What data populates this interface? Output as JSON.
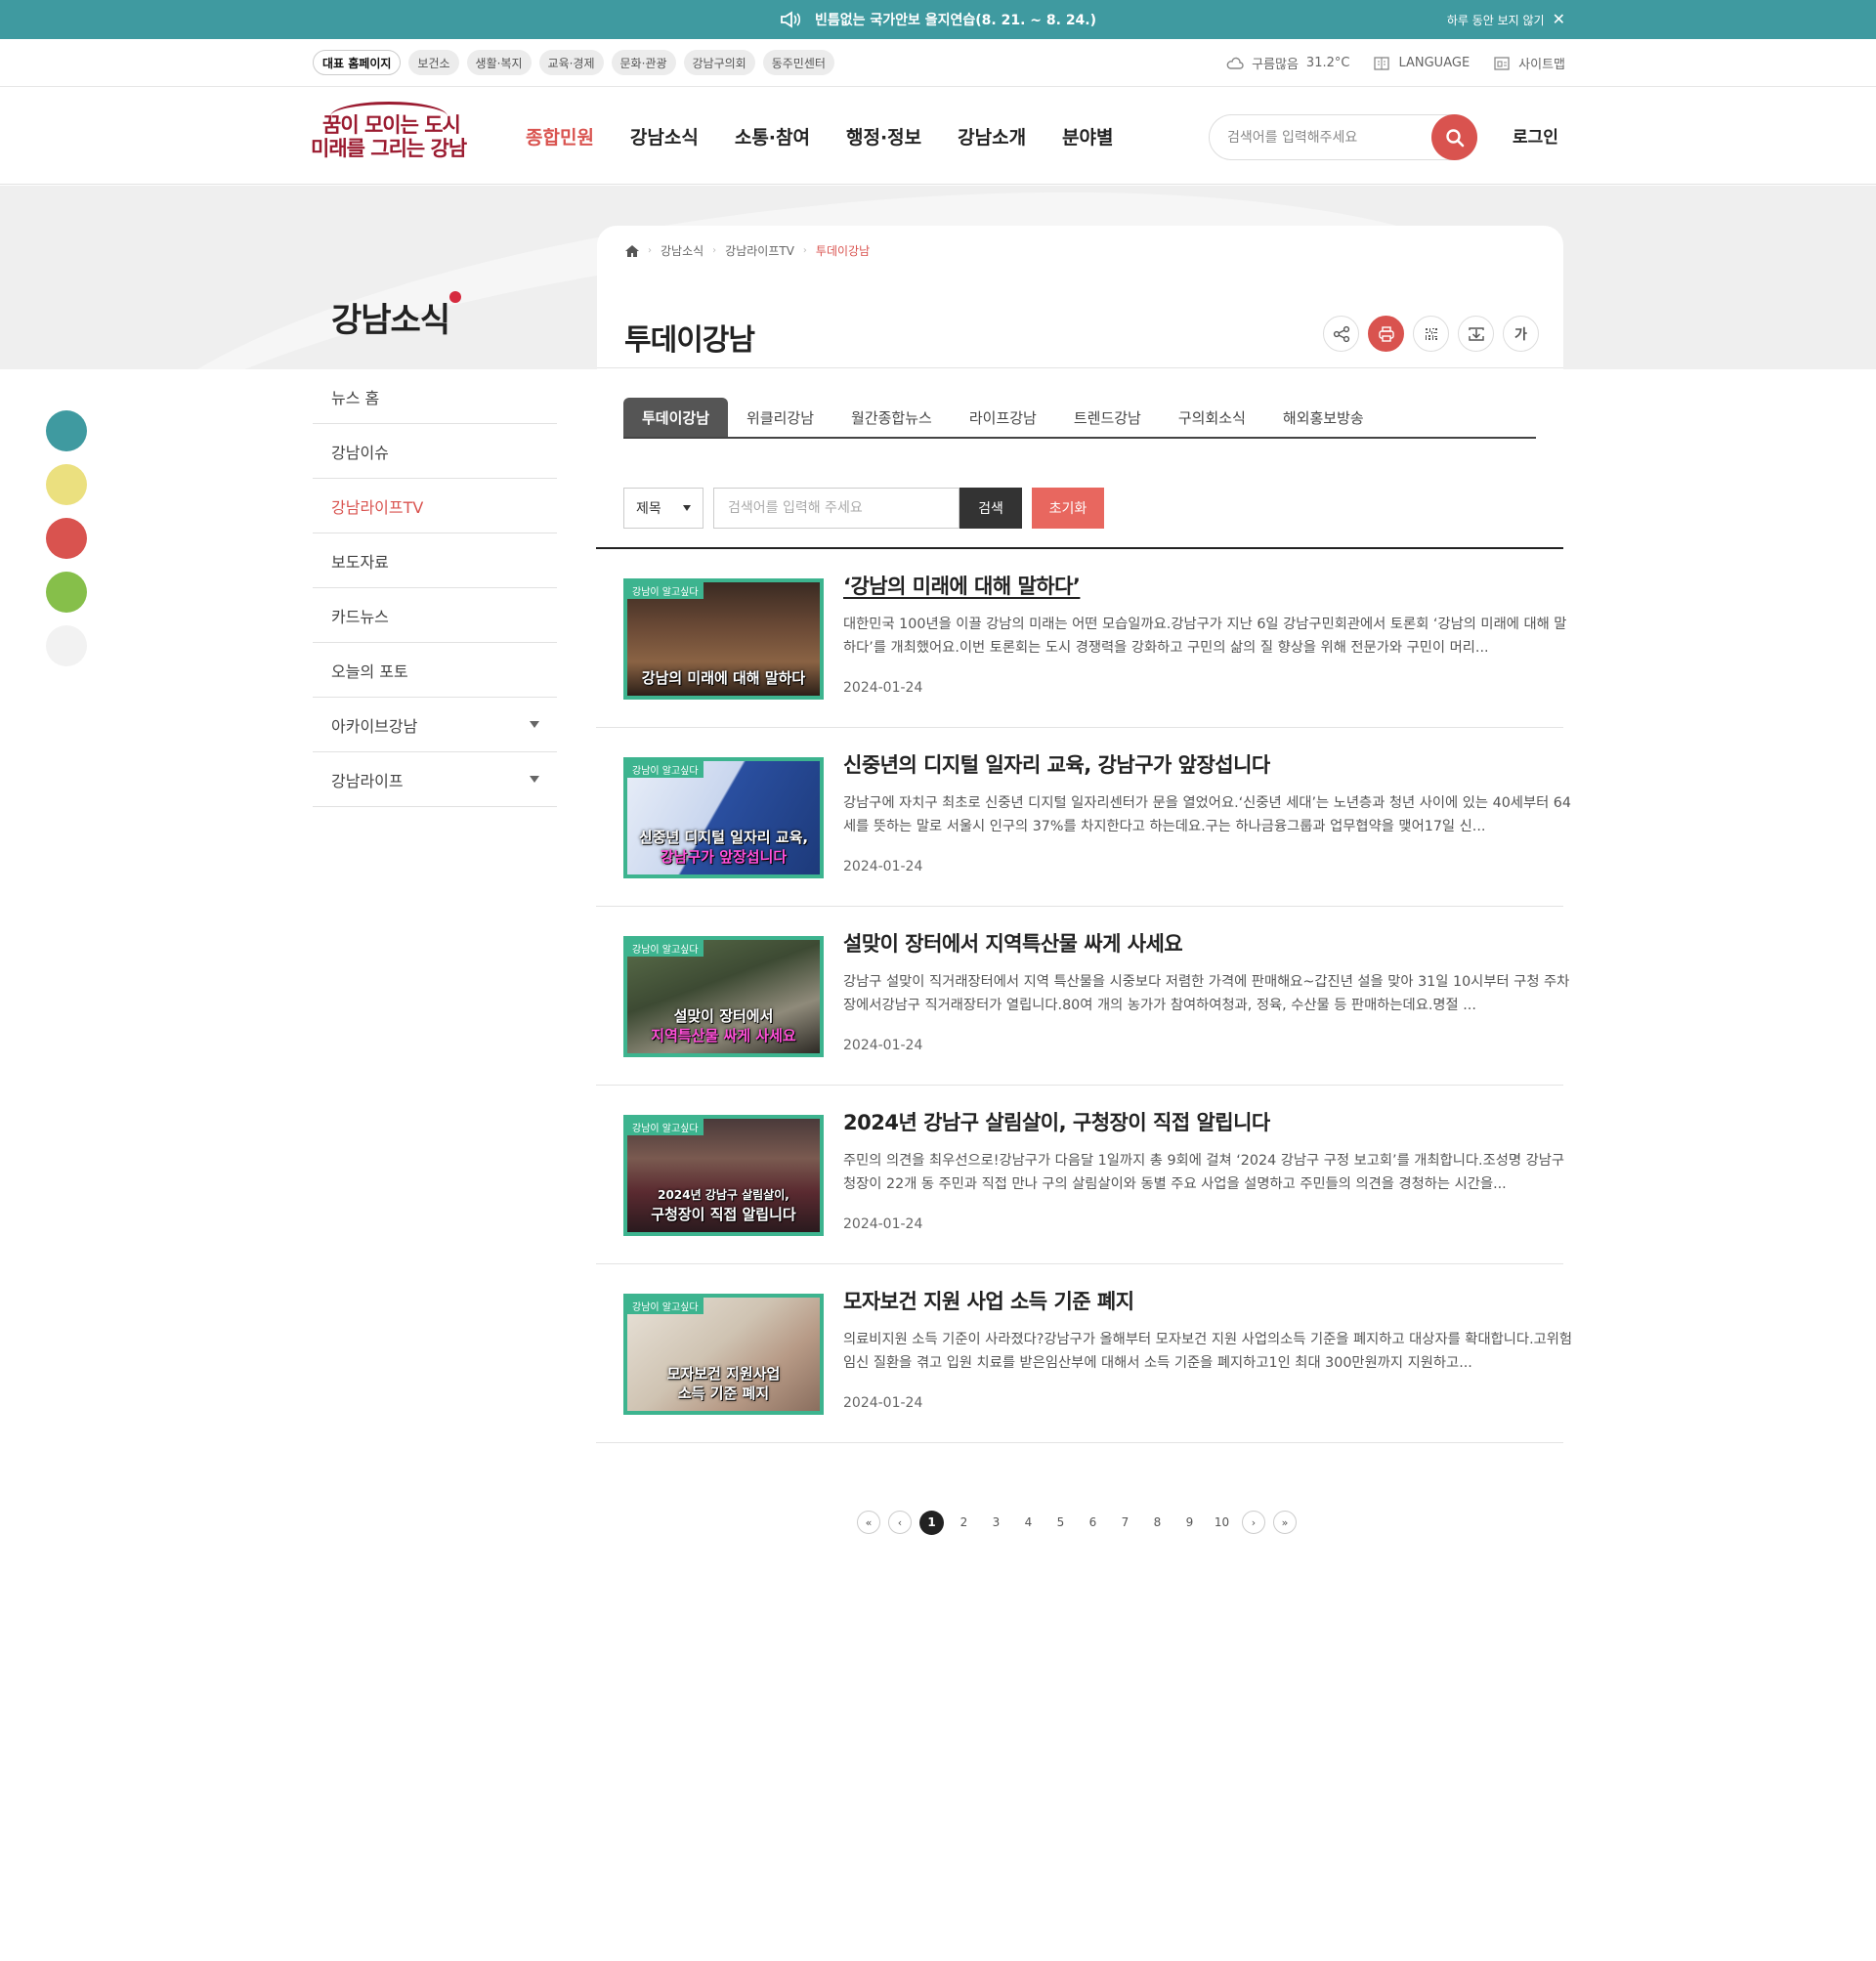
{
  "alert": {
    "message": "빈틈없는 국가안보 을지연습(8. 21. ~ 8. 24.)",
    "dismiss": "하루 동안 보지 않기",
    "close": "✕"
  },
  "util": {
    "sites": [
      "대표 홈페이지",
      "보건소",
      "생활·복지",
      "교육·경제",
      "문화·관광",
      "강남구의회",
      "동주민센터"
    ],
    "weather": "구름많음",
    "temperature": "31.2°C",
    "language": "LANGUAGE",
    "sitemap": "사이트맵"
  },
  "logo": {
    "line1": "꿈이 모이는 도시",
    "line2": "미래를 그리는 강남"
  },
  "gnb": [
    "종합민원",
    "강남소식",
    "소통·참여",
    "행정·정보",
    "강남소개",
    "분야별"
  ],
  "search": {
    "placeholder": "검색어를 입력해주세요"
  },
  "login": "로그인",
  "section_title": "강남소식",
  "lnb": [
    "뉴스 홈",
    "강남이슈",
    "강남라이프TV",
    "보도자료",
    "카드뉴스",
    "오늘의 포토",
    "아카이브강남",
    "강남라이프"
  ],
  "swatch_colors": [
    "#3f9aa0",
    "#ebe07f",
    "#d9534f",
    "#86bf4a",
    "#f2f2f2"
  ],
  "breadcrumb": [
    "강남소식",
    "강남라이프TV",
    "투데이강남"
  ],
  "page_title": "투데이강남",
  "tools": {
    "font": "가"
  },
  "tabs": [
    "투데이강남",
    "위클리강남",
    "월간종합뉴스",
    "라이프강남",
    "트렌드강남",
    "구의회소식",
    "해외홍보방송"
  ],
  "filter": {
    "select": "제목",
    "placeholder": "검색어를 입력해 주세요",
    "search": "검색",
    "reset": "초기화"
  },
  "articles": [
    {
      "title": "‘강남의 미래에 대해 말하다’",
      "desc": "대한민국 100년을 이끌 강남의 미래는 어떤 모습일까요.강남구가 지난 6일 강남구민회관에서 토론회 ‘강남의 미래에 대해 말하다’를 개최했어요.이번 토론회는 도시 경쟁력을 강화하고 구민의 삶의 질 향상을 위해 전문가와 구민이 머리...",
      "date": "2024-01-24",
      "tag": "강남이 알고싶다",
      "cap1": "강남의 미래에 대해 말하다",
      "cap2": ""
    },
    {
      "title": "신중년의 디지털 일자리 교육, 강남구가 앞장섭니다",
      "desc": "강남구에 자치구 최초로 신중년 디지털 일자리센터가 문을 열었어요.‘신중년 세대’는 노년층과 청년 사이에 있는 40세부터 64세를 뜻하는 말로 서울시 인구의 37%를 차지한다고 하는데요.구는 하나금융그룹과 업무협약을 맺어17일 신...",
      "date": "2024-01-24",
      "tag": "강남이 알고싶다",
      "cap1": "신중년 디지털 일자리 교육,",
      "cap2": "강남구가 앞장섭니다"
    },
    {
      "title": "설맞이 장터에서 지역특산물 싸게 사세요",
      "desc": "강남구 설맞이 직거래장터에서 지역 특산물을 시중보다 저렴한 가격에 판매해요~갑진년 설을 맞아 31일 10시부터 구청 주차장에서강남구 직거래장터가 열립니다.80여 개의 농가가 참여하여청과, 정육, 수산물 등 판매하는데요.명절 ...",
      "date": "2024-01-24",
      "tag": "강남이 알고싶다",
      "cap1": "설맞이 장터에서",
      "cap2": "지역특산물 싸게 사세요"
    },
    {
      "title": "2024년 강남구 살림살이, 구청장이 직접 알립니다",
      "desc": "주민의 의견을 최우선으로!강남구가 다음달 1일까지 총 9회에 걸쳐 ‘2024 강남구 구정 보고회’를 개최합니다.조성명 강남구청장이 22개 동 주민과 직접 만나 구의 살림살이와 동별 주요 사업을 설명하고 주민들의 의견을 경청하는 시간을...",
      "date": "2024-01-24",
      "tag": "강남이 알고싶다",
      "cap1": "2024년 강남구 살림살이,",
      "cap2": "구청장이 직접 알립니다"
    },
    {
      "title": "모자보건 지원 사업 소득 기준 폐지",
      "desc": "의료비지원 소득 기준이 사라졌다?강남구가 올해부터 모자보건 지원 사업의소득 기준을 폐지하고 대상자를 확대합니다.고위험 임신 질환을 겪고 입원 치료를 받은임산부에 대해서 소득 기준을 폐지하고1인 최대 300만원까지 지원하고...",
      "date": "2024-01-24",
      "tag": "강남이 알고싶다",
      "cap1": "모자보건 지원사업",
      "cap2": "소득 기준 폐지"
    }
  ],
  "pagination": {
    "pages": [
      "1",
      "2",
      "3",
      "4",
      "5",
      "6",
      "7",
      "8",
      "9",
      "10"
    ],
    "current": "1",
    "first": "«",
    "prev": "‹",
    "next": "›",
    "last": "»"
  }
}
